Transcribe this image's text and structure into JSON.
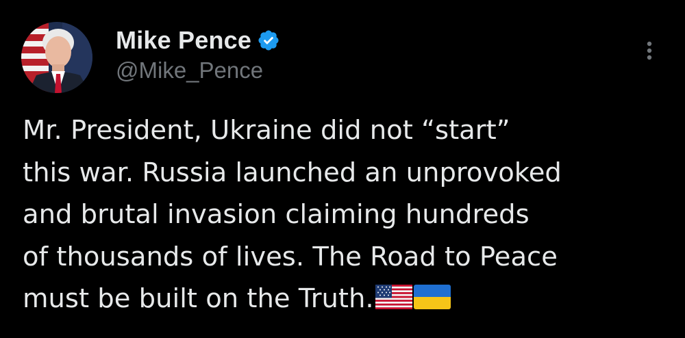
{
  "tweet": {
    "author": {
      "display_name": "Mike Pence",
      "handle": "@Mike_Pence",
      "verified": true,
      "avatar": "profile-photo"
    },
    "body_lines": [
      "Mr. President, Ukraine did not “start”",
      "this war. Russia launched an unprovoked",
      "and brutal invasion claiming hundreds",
      "of thousands of lives. The Road to Peace",
      "must be built on the Truth."
    ],
    "emoji": [
      "us-flag",
      "ukraine-flag"
    ],
    "menu_icon": "more-options-icon"
  },
  "colors": {
    "background": "#000000",
    "text": "#e7e9ea",
    "secondary_text": "#71767b",
    "verified_badge": "#1d9bf0"
  }
}
